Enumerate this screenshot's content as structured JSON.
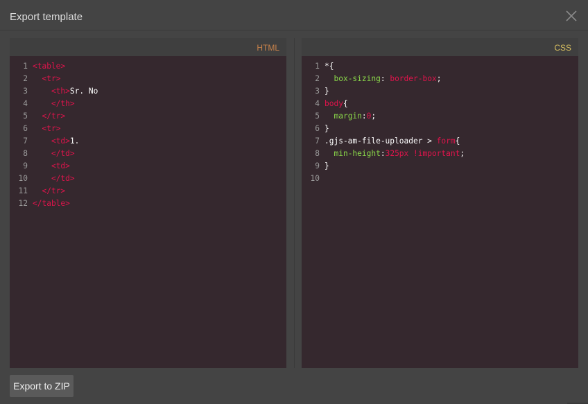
{
  "modal": {
    "title": "Export template"
  },
  "html_panel": {
    "label": "HTML",
    "lines": [
      {
        "n": "1",
        "indent": "",
        "parts": [
          [
            "tag",
            "<table>"
          ]
        ]
      },
      {
        "n": "2",
        "indent": "  ",
        "parts": [
          [
            "tag",
            "<tr>"
          ]
        ]
      },
      {
        "n": "3",
        "indent": "    ",
        "parts": [
          [
            "tag",
            "<th>"
          ],
          [
            "txt",
            "Sr. No"
          ]
        ]
      },
      {
        "n": "4",
        "indent": "    ",
        "parts": [
          [
            "tag",
            "</th>"
          ]
        ]
      },
      {
        "n": "5",
        "indent": "  ",
        "parts": [
          [
            "tag",
            "</tr>"
          ]
        ]
      },
      {
        "n": "6",
        "indent": "  ",
        "parts": [
          [
            "tag",
            "<tr>"
          ]
        ]
      },
      {
        "n": "7",
        "indent": "    ",
        "parts": [
          [
            "tag",
            "<td>"
          ],
          [
            "txt",
            "1."
          ]
        ]
      },
      {
        "n": "8",
        "indent": "    ",
        "parts": [
          [
            "tag",
            "</td>"
          ]
        ]
      },
      {
        "n": "9",
        "indent": "    ",
        "parts": [
          [
            "tag",
            "<td>"
          ]
        ]
      },
      {
        "n": "10",
        "indent": "    ",
        "parts": [
          [
            "tag",
            "</td>"
          ]
        ]
      },
      {
        "n": "11",
        "indent": "  ",
        "parts": [
          [
            "tag",
            "</tr>"
          ]
        ]
      },
      {
        "n": "12",
        "indent": "",
        "parts": [
          [
            "tag",
            "</table>"
          ]
        ]
      }
    ]
  },
  "css_panel": {
    "label": "CSS",
    "lines": [
      {
        "n": "1",
        "indent": "",
        "parts": [
          [
            "sel",
            "*{"
          ]
        ]
      },
      {
        "n": "2",
        "indent": "  ",
        "parts": [
          [
            "prop",
            "box-sizing"
          ],
          [
            "punc",
            ": "
          ],
          [
            "val",
            "border-box"
          ],
          [
            "punc",
            ";"
          ]
        ]
      },
      {
        "n": "3",
        "indent": "",
        "parts": [
          [
            "punc",
            "}"
          ]
        ]
      },
      {
        "n": "4",
        "indent": "",
        "parts": [
          [
            "tag",
            "body"
          ],
          [
            "punc",
            "{"
          ]
        ]
      },
      {
        "n": "5",
        "indent": "  ",
        "parts": [
          [
            "prop",
            "margin"
          ],
          [
            "punc",
            ":"
          ],
          [
            "val",
            "0"
          ],
          [
            "punc",
            ";"
          ]
        ]
      },
      {
        "n": "6",
        "indent": "",
        "parts": [
          [
            "punc",
            "}"
          ]
        ]
      },
      {
        "n": "7",
        "indent": "",
        "parts": [
          [
            "sel",
            ".gjs-am-file-uploader > "
          ],
          [
            "tag",
            "form"
          ],
          [
            "punc",
            "{"
          ]
        ]
      },
      {
        "n": "8",
        "indent": "  ",
        "parts": [
          [
            "prop",
            "min-height"
          ],
          [
            "punc",
            ":"
          ],
          [
            "val",
            "325px !important"
          ],
          [
            "punc",
            ";"
          ]
        ]
      },
      {
        "n": "9",
        "indent": "",
        "parts": [
          [
            "punc",
            "}"
          ]
        ]
      },
      {
        "n": "10",
        "indent": "",
        "parts": []
      }
    ]
  },
  "footer": {
    "export_label": "Export to ZIP"
  },
  "colors": {
    "background": "#444444",
    "editor_bg": "#35282e",
    "tag": "#e0144c",
    "property": "#8ad84a",
    "html_label": "#c8824a",
    "css_label": "#d9c060"
  }
}
